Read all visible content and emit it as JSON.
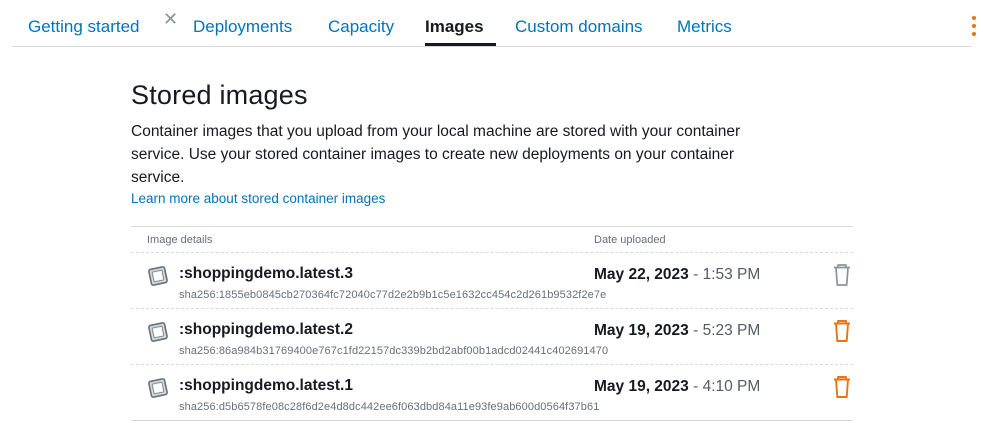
{
  "tabs": [
    {
      "label": "Getting started",
      "active": false
    },
    {
      "label": "Deployments",
      "active": false
    },
    {
      "label": "Capacity",
      "active": false
    },
    {
      "label": "Images",
      "active": true
    },
    {
      "label": "Custom domains",
      "active": false
    },
    {
      "label": "Metrics",
      "active": false
    }
  ],
  "icons": {
    "close": "close-icon",
    "menu": "vertical-dots-icon",
    "image": "container-image-icon",
    "delete": "trash-icon"
  },
  "colors": {
    "link": "#0073bb",
    "accent": "#ec7211",
    "disabled": "#879596",
    "text": "#16191f",
    "muted": "#687078"
  },
  "main": {
    "title": "Stored images",
    "description": "Container images that you upload from your local machine are stored with your container service. Use your stored container images to create new deployments on your container service.",
    "learn_more": "Learn more about stored container images"
  },
  "table": {
    "headers": {
      "details": "Image details",
      "date": "Date uploaded"
    },
    "rows": [
      {
        "name": ":shoppingdemo.latest.3",
        "sha": "sha256:1855eb0845cb270364fc72040c77d2e2b9b1c5e1632cc454c2d261b9532f2e7e",
        "date": "May 22, 2023",
        "separator": " - ",
        "time": "1:53 PM",
        "delete_enabled": false
      },
      {
        "name": ":shoppingdemo.latest.2",
        "sha": "sha256:86a984b31769400e767c1fd22157dc339b2bd2abf00b1adcd02441c402691470",
        "date": "May 19, 2023",
        "separator": " - ",
        "time": "5:23 PM",
        "delete_enabled": true
      },
      {
        "name": ":shoppingdemo.latest.1",
        "sha": "sha256:d5b6578fe08c28f6d2e4d8dc442ee6f063dbd84a11e93fe9ab600d0564f37b61",
        "date": "May 19, 2023",
        "separator": " - ",
        "time": "4:10 PM",
        "delete_enabled": true
      }
    ]
  }
}
